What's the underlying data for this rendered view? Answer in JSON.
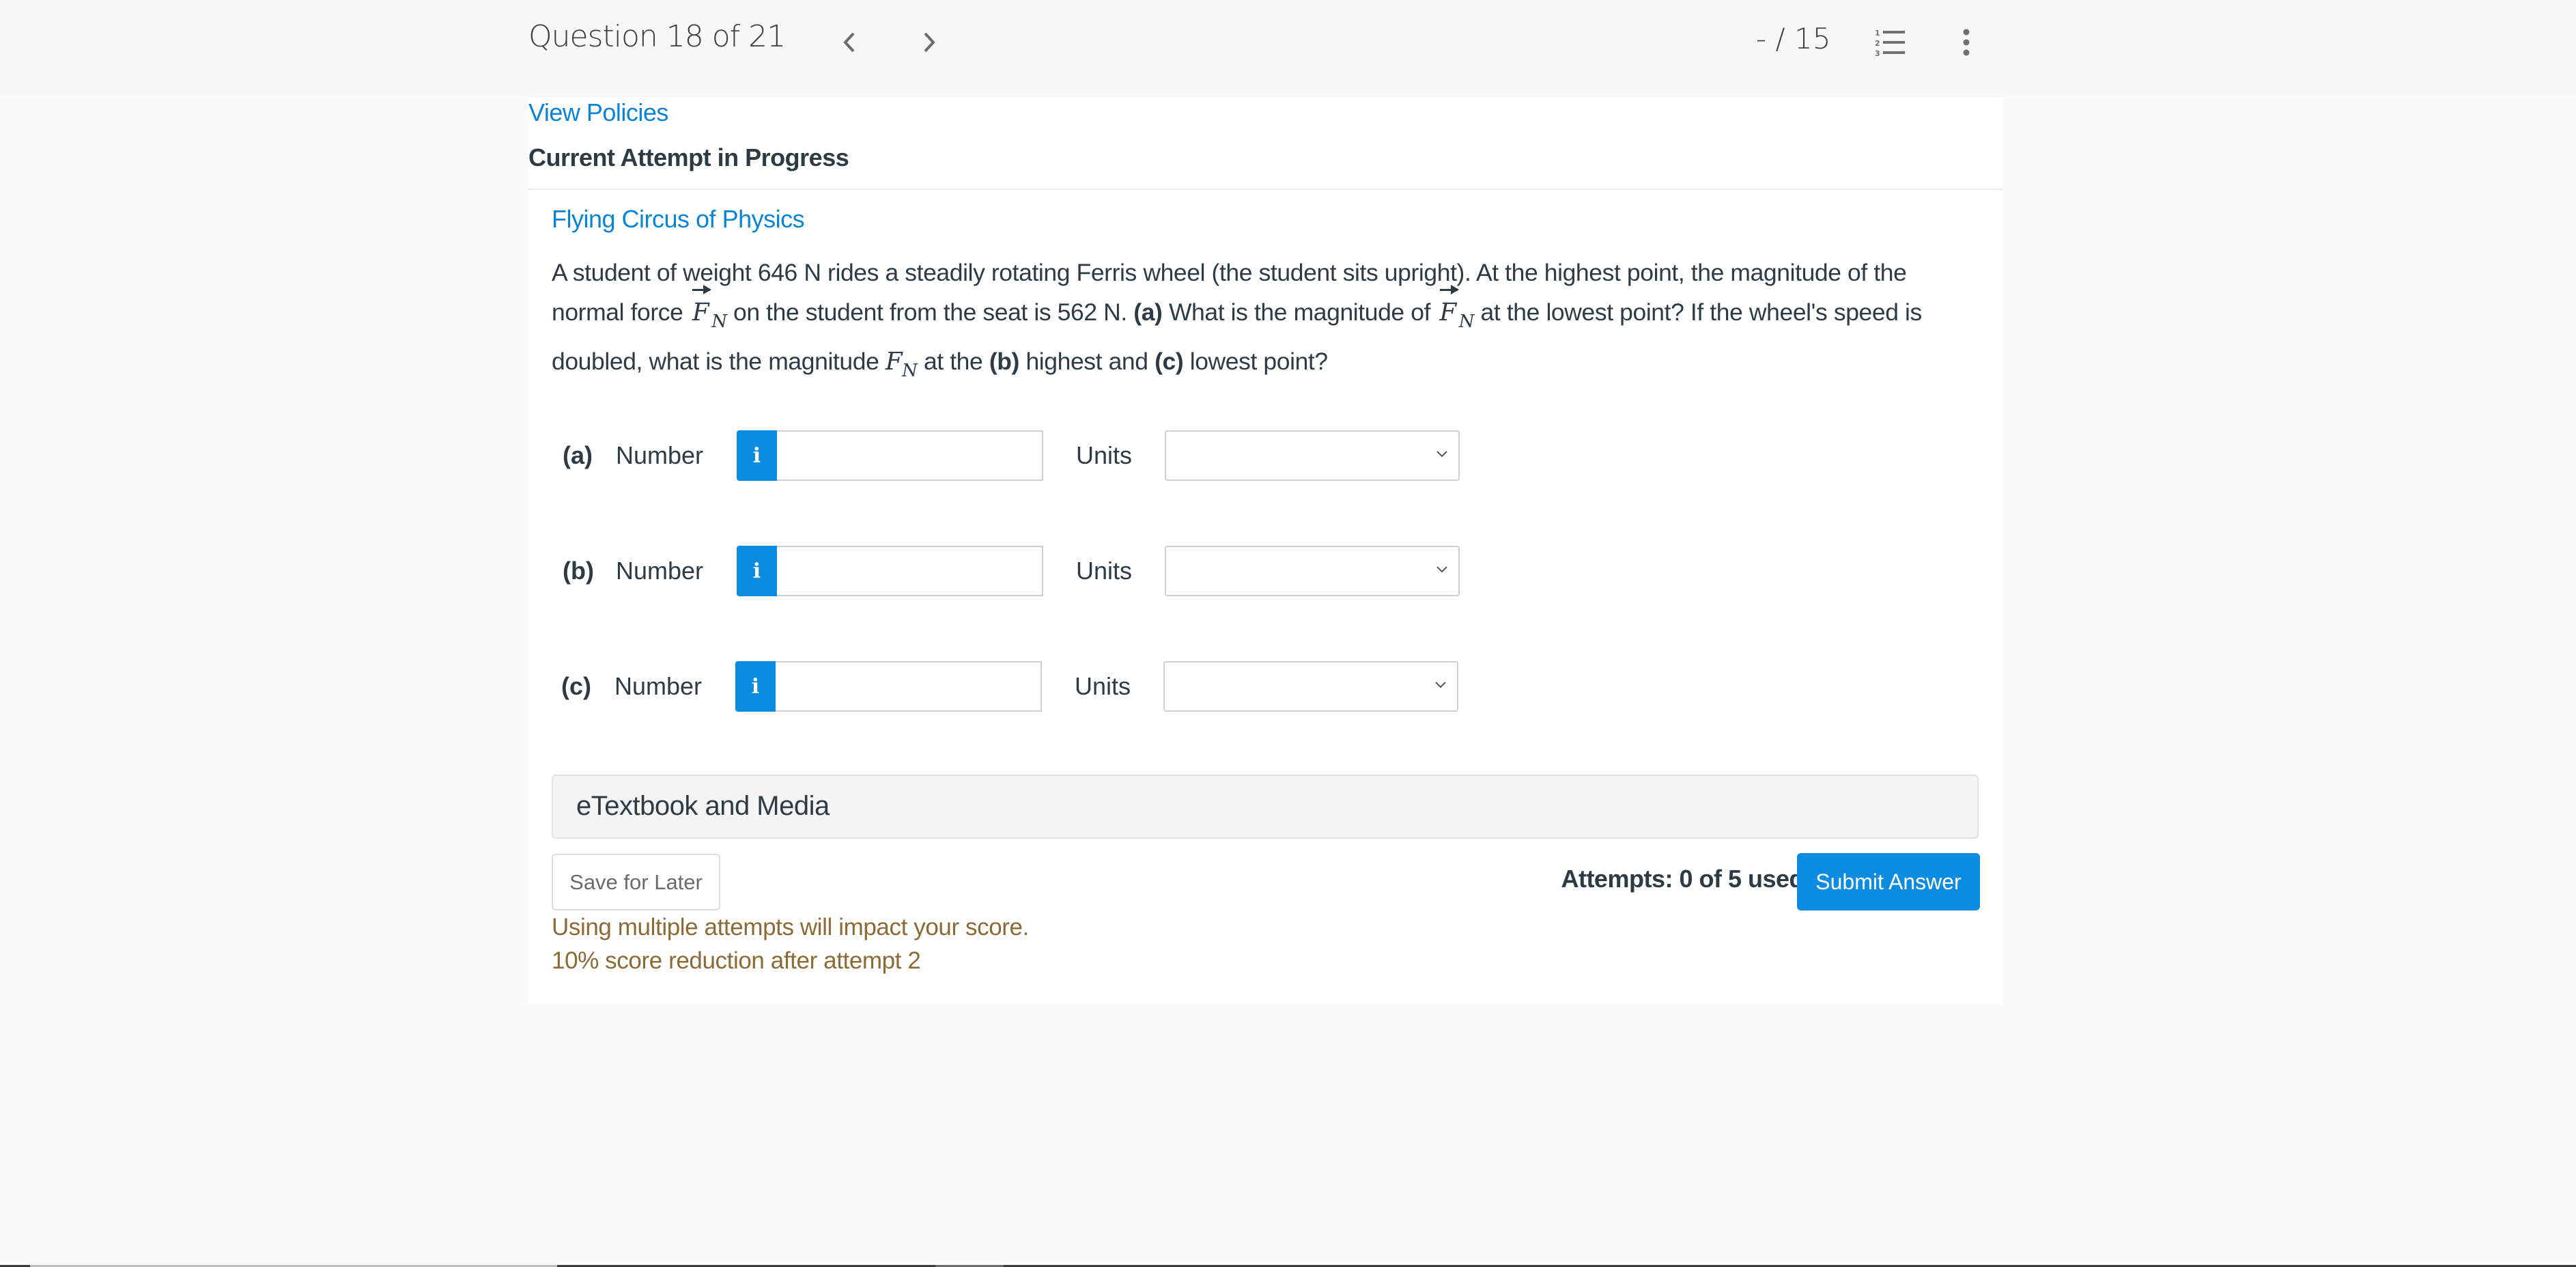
{
  "header": {
    "question_position": "Question 18 of 21",
    "prev_icon": "chevron-left-icon",
    "next_icon": "chevron-right-icon",
    "score": "- / 15",
    "list_icon": "numbered-list-icon",
    "more_icon": "vertical-ellipsis-icon"
  },
  "links": {
    "view_policies": "View Policies"
  },
  "attempt_heading": "Current Attempt in Progress",
  "question": {
    "source": "Flying Circus of Physics",
    "text_parts": {
      "p1": "A student of weight 646 N rides a steadily rotating Ferris wheel (the student sits upright). At the highest point, the magnitude of the normal force ",
      "vec_symbol": "F",
      "vec_subscript": "N",
      "p2": " on the student from the seat is 562 N. ",
      "a_label": "(a)",
      "p3": " What is the magnitude of ",
      "p4": " at the lowest point? If the wheel's speed is doubled, what is the magnitude ",
      "mag_symbol": "F",
      "mag_subscript": "N",
      "p5": " at the ",
      "b_label": "(b)",
      "p6": " highest and ",
      "c_label": "(c)",
      "p7": " lowest point?"
    }
  },
  "answers": [
    {
      "part": "(a)",
      "number_label": "Number",
      "info_icon": "i",
      "value": "",
      "units_label": "Units",
      "units_selected": ""
    },
    {
      "part": "(b)",
      "number_label": "Number",
      "info_icon": "i",
      "value": "",
      "units_label": "Units",
      "units_selected": ""
    },
    {
      "part": "(c)",
      "number_label": "Number",
      "info_icon": "i",
      "value": "",
      "units_label": "Units",
      "units_selected": ""
    }
  ],
  "etextbook": {
    "label": "eTextbook and Media"
  },
  "footer": {
    "save_label": "Save for Later",
    "attempts": "Attempts: 0 of 5 used",
    "submit_label": "Submit Answer",
    "warning_1": "Using multiple attempts will impact your score.",
    "warning_2": "10% score reduction after attempt 2"
  },
  "colors": {
    "accent": "#0b8ce0",
    "link": "#0a84d6",
    "warning_text": "#8b6a36",
    "body_text": "#2d3b45"
  }
}
